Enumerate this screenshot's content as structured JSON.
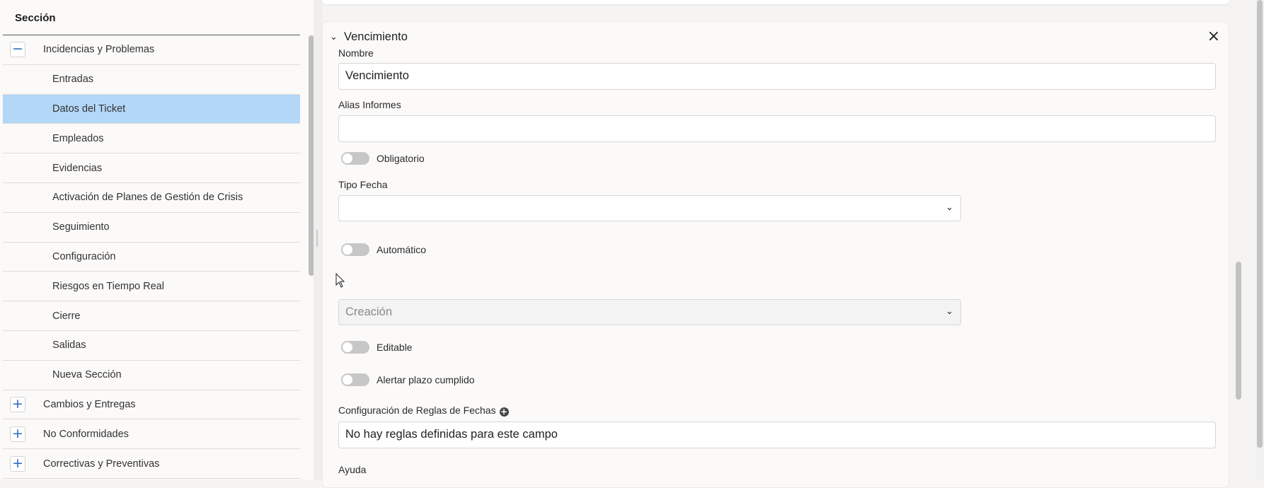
{
  "left_panel": {
    "header": "Sección",
    "groups": [
      {
        "toggle": "−",
        "label": "Incidencias y Problemas",
        "expanded": true
      },
      {
        "toggle": "+",
        "label": "Cambios y Entregas"
      },
      {
        "toggle": "+",
        "label": "No Conformidades"
      },
      {
        "toggle": "+",
        "label": "Correctivas y Preventivas"
      }
    ],
    "children": [
      "Entradas",
      "Datos del Ticket",
      "Empleados",
      "Evidencias",
      "Activación de Planes de Gestión de Crisis",
      "Seguimiento",
      "Configuración",
      "Riesgos en Tiempo Real",
      "Cierre",
      "Salidas",
      "Nueva Sección"
    ],
    "selected_child": "Datos del Ticket"
  },
  "field_card": {
    "title": "Vencimiento",
    "close_icon": "×",
    "chevron_icon": "⌄",
    "nombre_label": "Nombre",
    "nombre_value": "Vencimiento",
    "alias_label": "Alias Informes",
    "alias_value": "",
    "obligatorio_label": "Obligatorio",
    "tipo_fecha_label": "Tipo Fecha",
    "tipo_fecha_value": "",
    "automatico_label": "Automático",
    "automatico_select_value": "Creación",
    "editable_label": "Editable",
    "alertar_label": "Alertar plazo cumplido",
    "reglas_label": "Configuración de Reglas de Fechas",
    "reglas_value": "No hay reglas definidas para este campo",
    "ayuda_label": "Ayuda"
  },
  "colors": {
    "selected_row": "#b3d8f7",
    "toggle_icon": "#2d66c4",
    "switch_off": "#c7c7c7"
  }
}
